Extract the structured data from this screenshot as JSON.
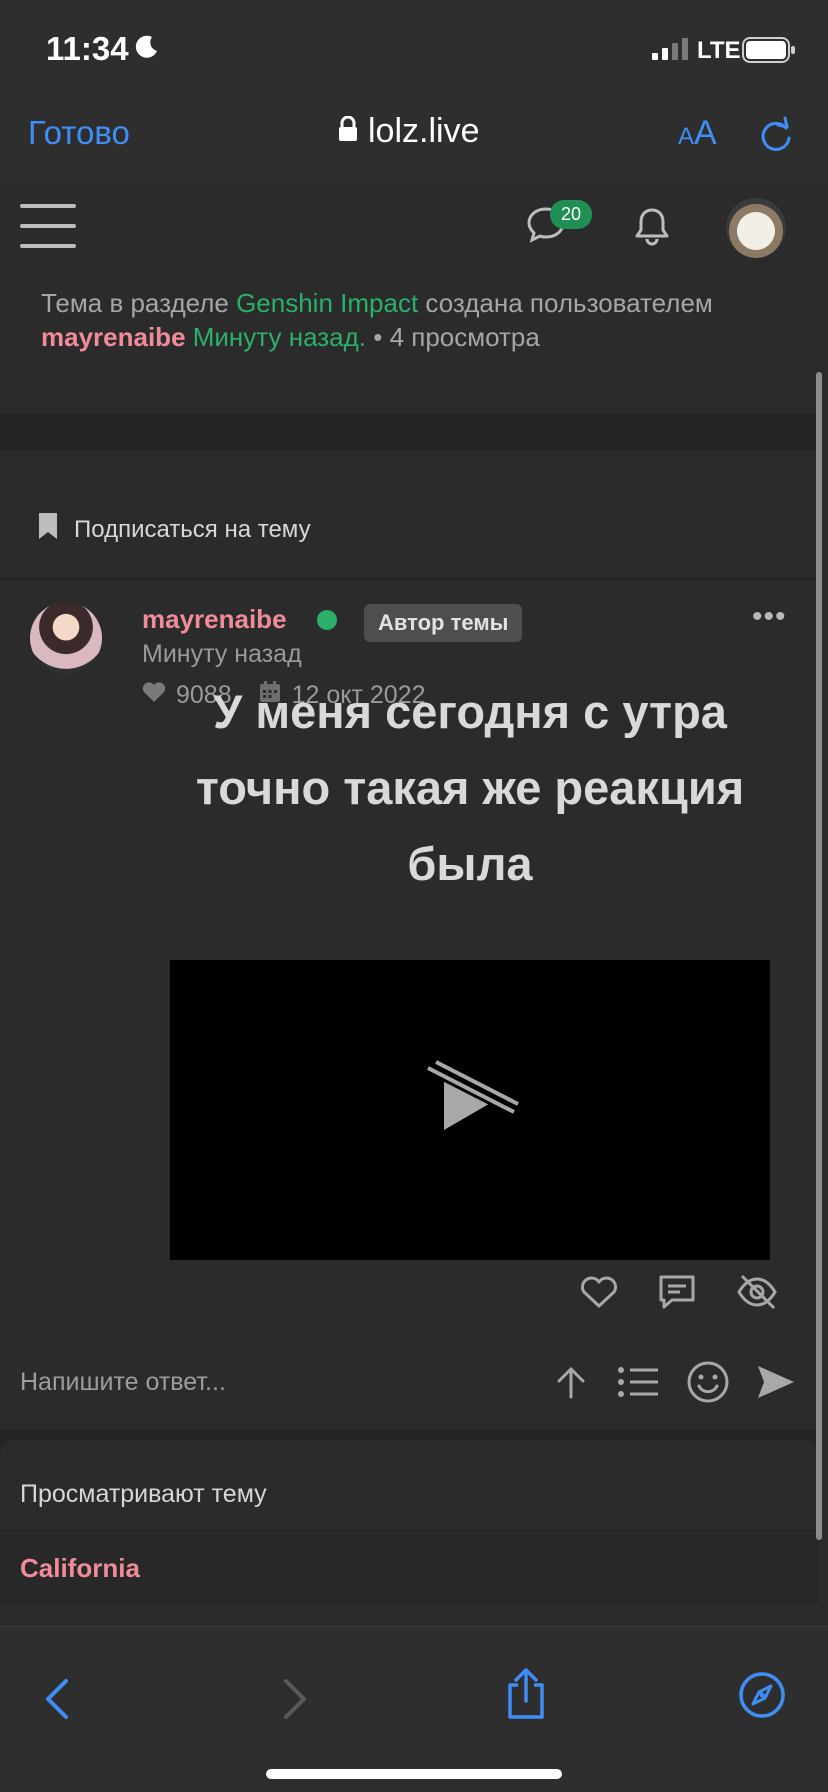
{
  "status_bar": {
    "time": "11:34",
    "network": "LTE"
  },
  "browser": {
    "done_label": "Готово",
    "url": "lolz.live",
    "text_size_label_small": "A",
    "text_size_label_large": "A"
  },
  "forum_header": {
    "chat_badge_count": "20"
  },
  "thread_info": {
    "part1": "Тема в разделе ",
    "section": "Genshin Impact",
    "part2": " создана пользователем ",
    "author": "mayrenaibe",
    "time": " Минуту назад.",
    "views": " • 4 просмотра"
  },
  "subscribe": {
    "label": "Подписаться на тему"
  },
  "post": {
    "author": "mayrenaibe",
    "badge": "Автор темы",
    "more": "•••",
    "time": "Минуту назад",
    "likes": "9088",
    "date": "12 окт 2022",
    "title": "У меня сегодня с утра точно такая же реакция была"
  },
  "reply": {
    "placeholder": "Напишите ответ..."
  },
  "viewing": {
    "title": "Просматривают тему",
    "users": [
      "California"
    ]
  },
  "colors": {
    "accent_blue": "#3f8ef5",
    "green": "#2bb06c",
    "pink": "#f08c9a",
    "background": "#2b2b2b"
  }
}
